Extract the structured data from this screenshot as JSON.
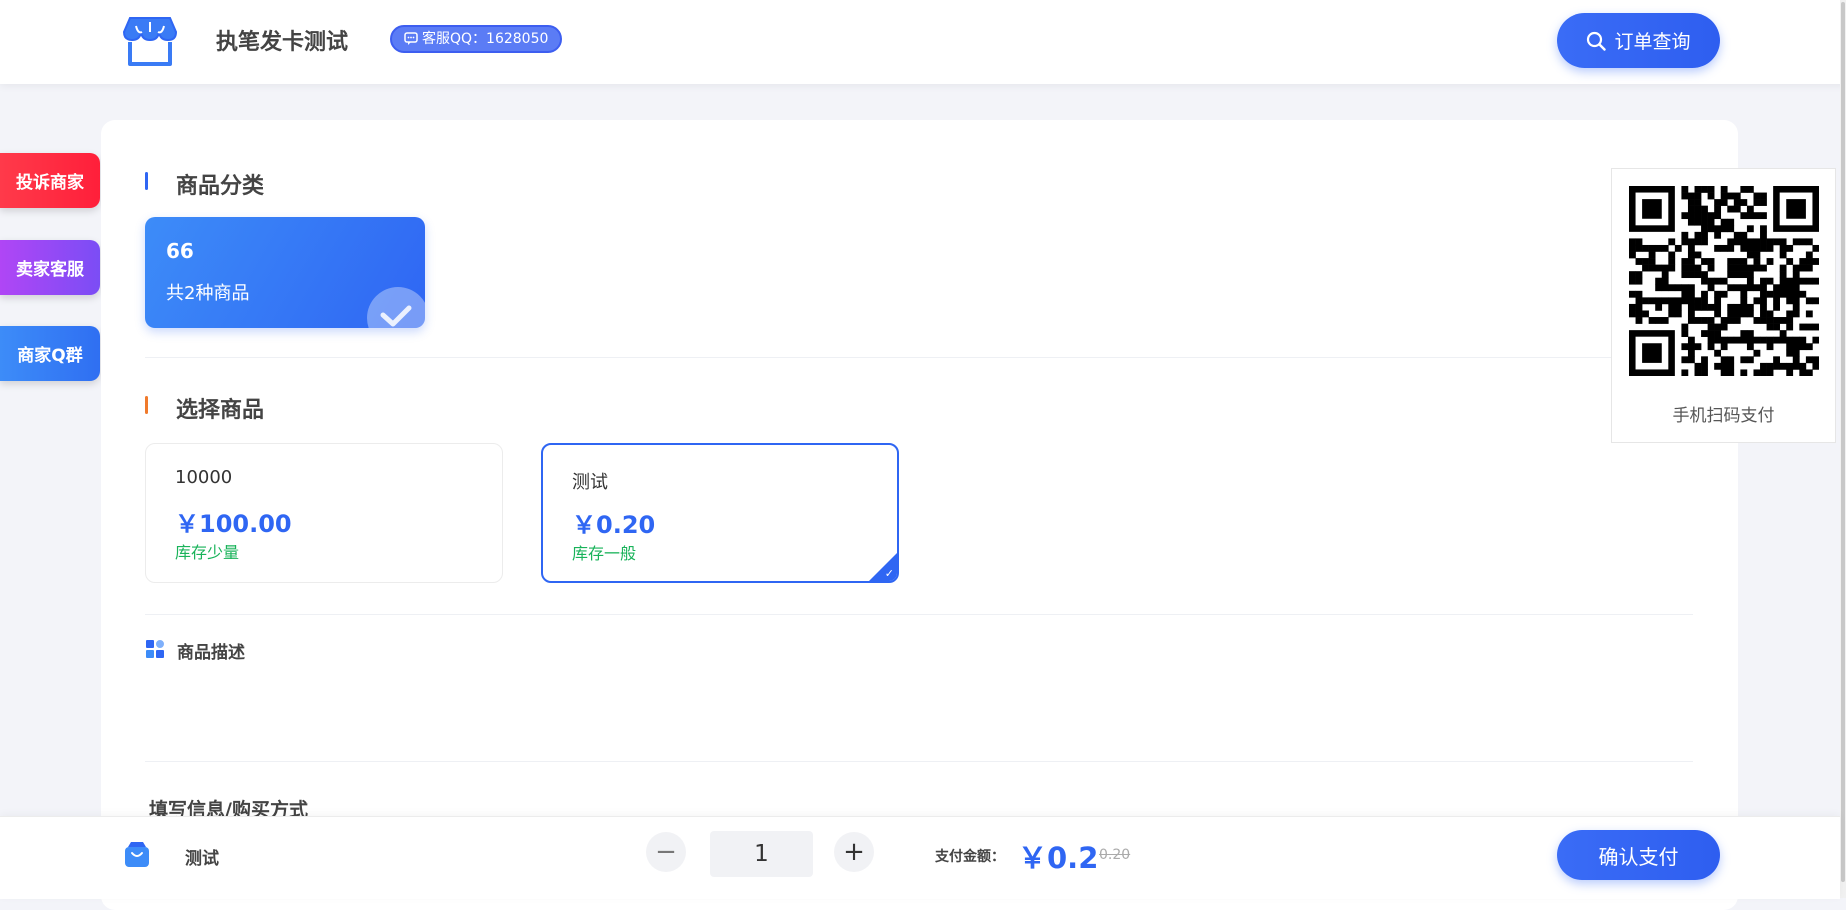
{
  "header": {
    "site_title": "执笔发卡测试",
    "qq_badge": "客服QQ：1628050",
    "order_query_label": "订单查询"
  },
  "side_buttons": {
    "complain": "投诉商家",
    "seller_service": "卖家客服",
    "merchant_group": "商家Q群"
  },
  "categories": {
    "title": "商品分类",
    "items": [
      {
        "name": "66",
        "count_label": "共2种商品",
        "selected": true
      }
    ]
  },
  "products": {
    "title": "选择商品",
    "items": [
      {
        "name": "10000",
        "price": "￥100.00",
        "stock": "库存少量",
        "selected": false
      },
      {
        "name": "测试",
        "price": "￥0.20",
        "stock": "库存一般",
        "selected": true
      }
    ]
  },
  "description": {
    "title": "商品描述"
  },
  "fill_info": {
    "title": "填写信息/购买方式"
  },
  "qr": {
    "label": "手机扫码支付"
  },
  "bottom_bar": {
    "product_name": "测试",
    "quantity": "1",
    "pay_label": "支付金额：",
    "pay_amount": "￥0.2",
    "original_price": "0.20",
    "confirm_label": "确认支付"
  },
  "colors": {
    "primary": "#2f66f3",
    "complain": "#ff2a40",
    "service": "#9a4af5",
    "group": "#3579f5",
    "stock_green": "#19b35a"
  }
}
